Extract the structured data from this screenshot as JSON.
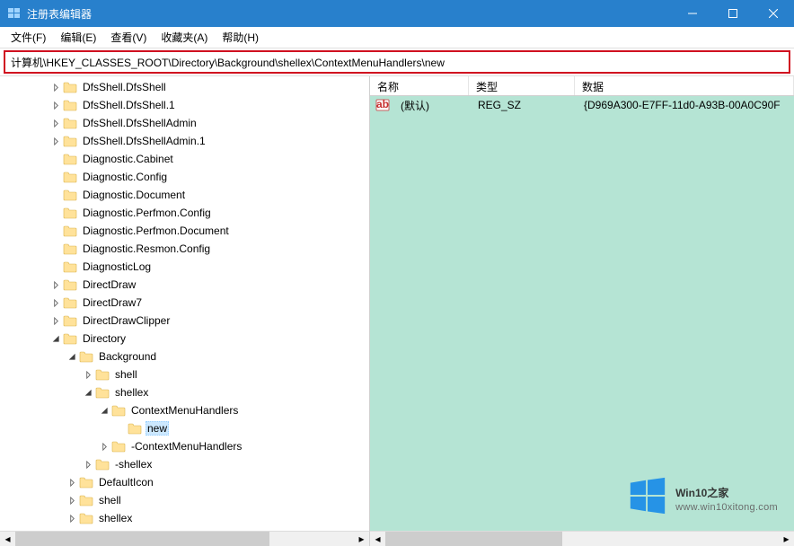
{
  "window": {
    "title": "注册表编辑器"
  },
  "menu": {
    "file": "文件(F)",
    "edit": "编辑(E)",
    "view": "查看(V)",
    "favorites": "收藏夹(A)",
    "help": "帮助(H)"
  },
  "address": "计算机\\HKEY_CLASSES_ROOT\\Directory\\Background\\shellex\\ContextMenuHandlers\\new",
  "columns": {
    "name": "名称",
    "type": "类型",
    "data": "数据"
  },
  "values": [
    {
      "name": "(默认)",
      "type": "REG_SZ",
      "data": "{D969A300-E7FF-11d0-A93B-00A0C90F"
    }
  ],
  "tree": [
    {
      "level": 2,
      "arrow": "closed",
      "label": "DfsShell.DfsShell"
    },
    {
      "level": 2,
      "arrow": "closed",
      "label": "DfsShell.DfsShell.1"
    },
    {
      "level": 2,
      "arrow": "closed",
      "label": "DfsShell.DfsShellAdmin"
    },
    {
      "level": 2,
      "arrow": "closed",
      "label": "DfsShell.DfsShellAdmin.1"
    },
    {
      "level": 2,
      "arrow": "none",
      "label": "Diagnostic.Cabinet"
    },
    {
      "level": 2,
      "arrow": "none",
      "label": "Diagnostic.Config"
    },
    {
      "level": 2,
      "arrow": "none",
      "label": "Diagnostic.Document"
    },
    {
      "level": 2,
      "arrow": "none",
      "label": "Diagnostic.Perfmon.Config"
    },
    {
      "level": 2,
      "arrow": "none",
      "label": "Diagnostic.Perfmon.Document"
    },
    {
      "level": 2,
      "arrow": "none",
      "label": "Diagnostic.Resmon.Config"
    },
    {
      "level": 2,
      "arrow": "none",
      "label": "DiagnosticLog"
    },
    {
      "level": 2,
      "arrow": "closed",
      "label": "DirectDraw"
    },
    {
      "level": 2,
      "arrow": "closed",
      "label": "DirectDraw7"
    },
    {
      "level": 2,
      "arrow": "closed",
      "label": "DirectDrawClipper"
    },
    {
      "level": 2,
      "arrow": "open",
      "label": "Directory"
    },
    {
      "level": 3,
      "arrow": "open",
      "label": "Background"
    },
    {
      "level": 4,
      "arrow": "closed",
      "label": "shell"
    },
    {
      "level": 4,
      "arrow": "open",
      "label": "shellex"
    },
    {
      "level": 5,
      "arrow": "open",
      "label": "ContextMenuHandlers"
    },
    {
      "level": 6,
      "arrow": "none",
      "label": "new",
      "selected": true
    },
    {
      "level": 5,
      "arrow": "closed",
      "label": "-ContextMenuHandlers"
    },
    {
      "level": 4,
      "arrow": "closed",
      "label": "-shellex"
    },
    {
      "level": 3,
      "arrow": "closed",
      "label": "DefaultIcon"
    },
    {
      "level": 3,
      "arrow": "closed",
      "label": "shell"
    },
    {
      "level": 3,
      "arrow": "closed",
      "label": "shellex"
    }
  ],
  "watermark": {
    "brand": "Win10",
    "suffix": "之家",
    "url": "www.win10xitong.com"
  }
}
